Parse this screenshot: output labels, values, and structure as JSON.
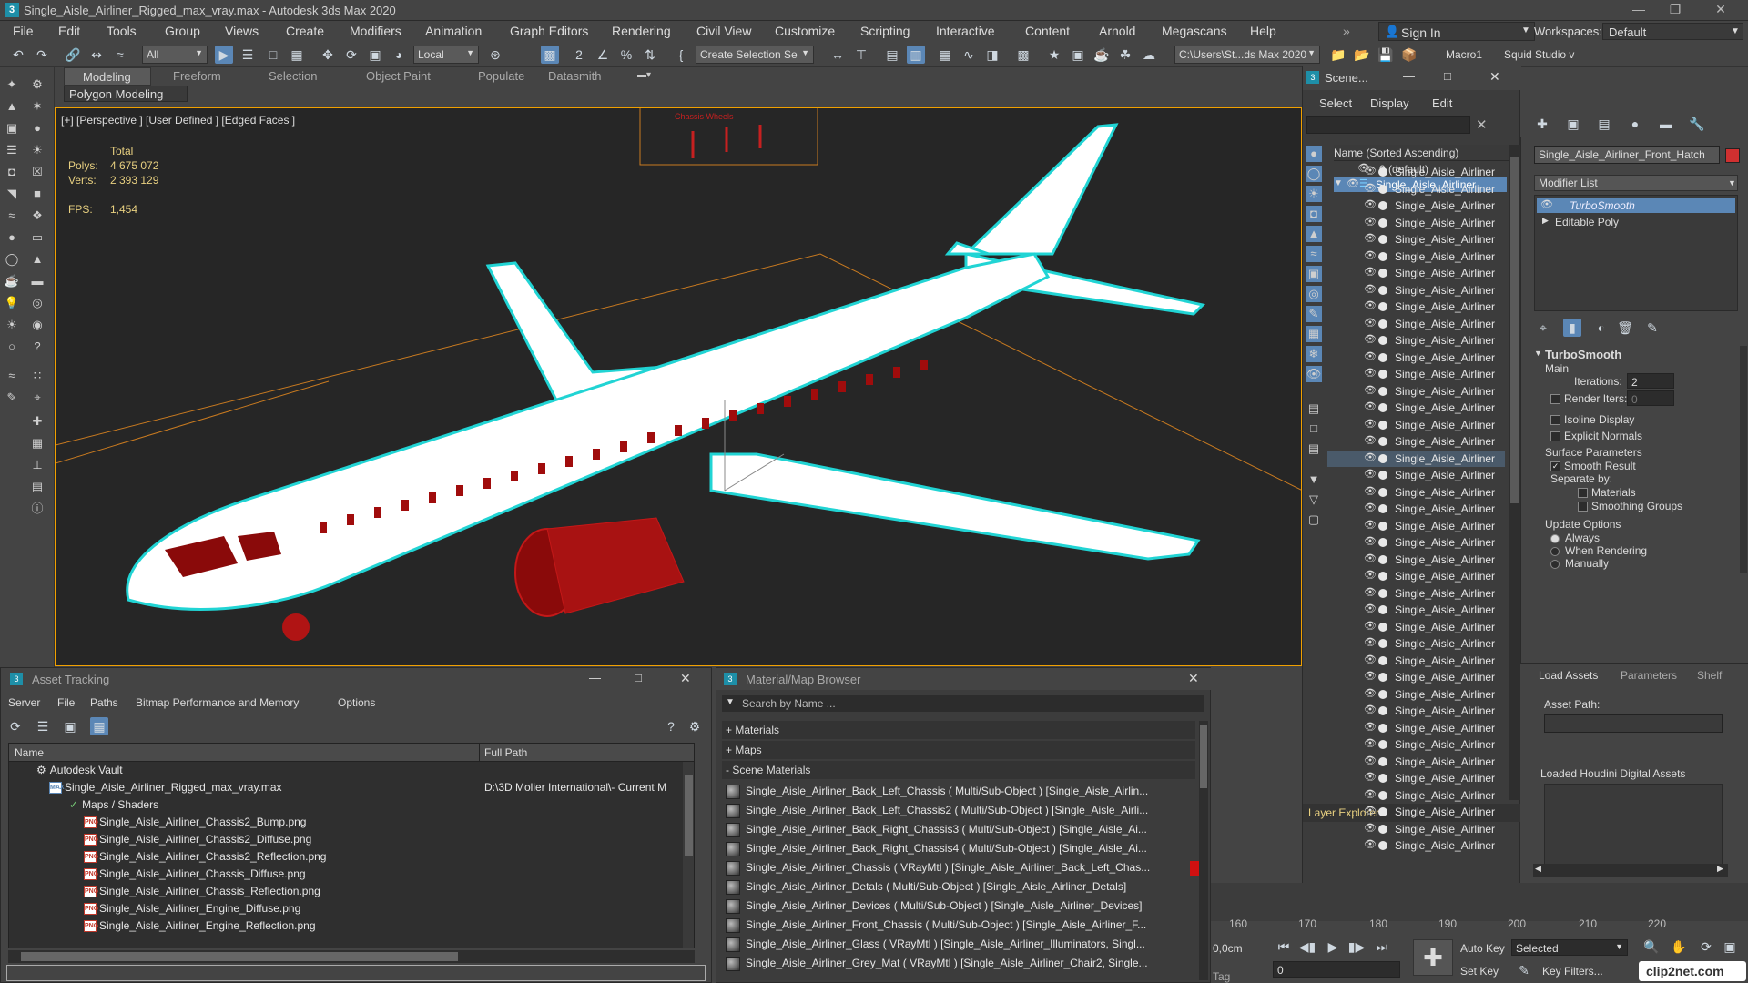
{
  "window": {
    "title": "Single_Aisle_Airliner_Rigged_max_vray.max - Autodesk 3ds Max 2020"
  },
  "menu": [
    "File",
    "Edit",
    "Tools",
    "Group",
    "Views",
    "Create",
    "Modifiers",
    "Animation",
    "Graph Editors",
    "Rendering",
    "Civil View",
    "Customize",
    "Scripting",
    "Interactive",
    "Content",
    "Arnold",
    "Megascans",
    "Help"
  ],
  "account": {
    "sign_in": "Sign In",
    "workspaces_label": "Workspaces:",
    "workspace": "Default"
  },
  "toolbar": {
    "filter": "All",
    "coord": "Local",
    "selection_set": "Create Selection Se",
    "path": "C:\\Users\\St...ds Max 2020",
    "macro": "Macro1",
    "squid": "Squid Studio v"
  },
  "ribbon": {
    "tabs": [
      "Modeling",
      "Freeform",
      "Selection",
      "Object Paint",
      "Populate",
      "Datasmith"
    ],
    "sub": "Polygon Modeling"
  },
  "viewport": {
    "label": "[+] [Perspective ] [User Defined ] [Edged Faces ]",
    "stats_total": "Total",
    "polys_label": "Polys:",
    "polys": "4 675 072",
    "verts_label": "Verts:",
    "verts": "2 393 129",
    "fps_label": "FPS:",
    "fps": "1,454",
    "sign_text": "Chassis  Wheels"
  },
  "scene_explorer": {
    "title": "Scene...",
    "menus": [
      "Select",
      "Display",
      "Edit"
    ],
    "column": "Name (Sorted Ascending)",
    "default_layer": "0 (default)",
    "root": "Single_Aisle_Airliner",
    "child_label": "Single_Aisle_Airliner",
    "child_count": 41,
    "footer": "Layer Explorer"
  },
  "command_panel": {
    "object_name": "Single_Aisle_Airliner_Front_Hatch",
    "object_color": "#d03030",
    "modifier_list": "Modifier List",
    "stack": [
      "TurboSmooth",
      "Editable Poly"
    ],
    "rollout": "TurboSmooth",
    "main": "Main",
    "iterations_label": "Iterations:",
    "iterations": "2",
    "render_iters_label": "Render Iters:",
    "render_iters": "0",
    "isoline": "Isoline Display",
    "explicit": "Explicit Normals",
    "surface_params": "Surface Parameters",
    "smooth_result": "Smooth Result",
    "separate_by": "Separate by:",
    "materials": "Materials",
    "smoothing_groups": "Smoothing Groups",
    "update_options": "Update Options",
    "always": "Always",
    "when_rendering": "When Rendering",
    "manually": "Manually"
  },
  "hda": {
    "tabs": [
      "Load Assets",
      "Parameters",
      "Shelf"
    ],
    "asset_path": "Asset Path:",
    "loaded": "Loaded Houdini Digital Assets"
  },
  "asset_tracking": {
    "title": "Asset Tracking",
    "menus": [
      "Server",
      "File",
      "Paths",
      "Bitmap Performance and Memory",
      "Options"
    ],
    "col_name": "Name",
    "col_path": "Full Path",
    "vault": "Autodesk Vault",
    "file": "Single_Aisle_Airliner_Rigged_max_vray.max",
    "file_path": "D:\\3D Molier International\\- Current M",
    "maps_folder": "Maps / Shaders",
    "maps": [
      "Single_Aisle_Airliner_Chassis2_Bump.png",
      "Single_Aisle_Airliner_Chassis2_Diffuse.png",
      "Single_Aisle_Airliner_Chassis2_Reflection.png",
      "Single_Aisle_Airliner_Chassis_Diffuse.png",
      "Single_Aisle_Airliner_Chassis_Reflection.png",
      "Single_Aisle_Airliner_Engine_Diffuse.png",
      "Single_Aisle_Airliner_Engine_Reflection.png"
    ]
  },
  "material_browser": {
    "title": "Material/Map Browser",
    "search": "Search by Name ...",
    "sections": [
      "+ Materials",
      "+ Maps",
      "- Scene Materials"
    ],
    "items": [
      "Single_Aisle_Airliner_Back_Left_Chassis ( Multi/Sub-Object ) [Single_Aisle_Airlin...",
      "Single_Aisle_Airliner_Back_Left_Chassis2 ( Multi/Sub-Object ) [Single_Aisle_Airli...",
      "Single_Aisle_Airliner_Back_Right_Chassis3 ( Multi/Sub-Object ) [Single_Aisle_Ai...",
      "Single_Aisle_Airliner_Back_Right_Chassis4 ( Multi/Sub-Object ) [Single_Aisle_Ai...",
      "Single_Aisle_Airliner_Chassis ( VRayMtl ) [Single_Aisle_Airliner_Back_Left_Chas...",
      "Single_Aisle_Airliner_Detals ( Multi/Sub-Object ) [Single_Aisle_Airliner_Detals]",
      "Single_Aisle_Airliner_Devices ( Multi/Sub-Object ) [Single_Aisle_Airliner_Devices]",
      "Single_Aisle_Airliner_Front_Chassis ( Multi/Sub-Object ) [Single_Aisle_Airliner_F...",
      "Single_Aisle_Airliner_Glass ( VRayMtl ) [Single_Aisle_Airliner_Illuminators, Singl...",
      "Single_Aisle_Airliner_Grey_Mat ( VRayMtl ) [Single_Aisle_Airliner_Chair2, Single..."
    ]
  },
  "timeline": {
    "ticks": [
      "160",
      "170",
      "180",
      "190",
      "200",
      "210",
      "220"
    ],
    "coord": "0,0cm",
    "frame": "0",
    "auto_key": "Auto Key",
    "set_key": "Set Key",
    "selected": "Selected",
    "key_filters": "Key Filters...",
    "tag": "Tag"
  },
  "watermark": "clip2net.com"
}
